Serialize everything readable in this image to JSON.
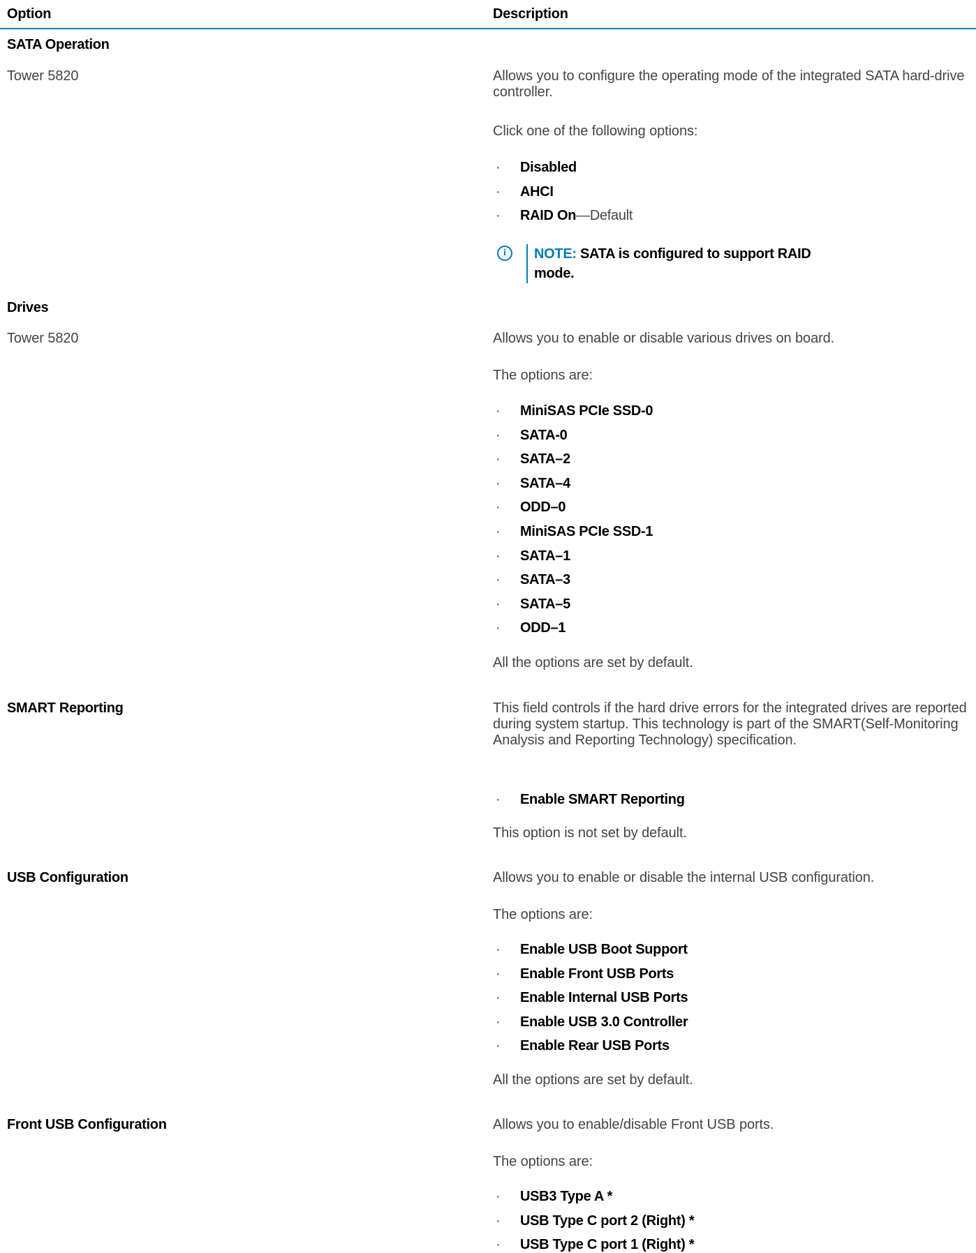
{
  "table": {
    "header": {
      "option": "Option",
      "description": "Description"
    }
  },
  "sata_operation": {
    "title": "SATA Operation",
    "model": "Tower 5820",
    "description": "Allows you to configure the operating mode of the integrated SATA hard-drive controller.",
    "prompt": "Click one of the following options:",
    "options": [
      {
        "label": "Disabled",
        "suffix": ""
      },
      {
        "label": "AHCI",
        "suffix": ""
      },
      {
        "label": "RAID On",
        "suffix": "—Default"
      }
    ],
    "note_label": "NOTE:",
    "note_text": " SATA is configured to support RAID mode."
  },
  "drives": {
    "title": "Drives",
    "model": "Tower 5820",
    "description": "Allows you to enable or disable various drives on board.",
    "prompt": "The options are:",
    "options": [
      "MiniSAS PCIe SSD-0",
      "SATA-0",
      "SATA–2",
      "SATA–4",
      "ODD–0",
      "MiniSAS PCIe SSD-1",
      "SATA–1",
      "SATA–3",
      "SATA–5",
      "ODD–1"
    ],
    "footer": "All the options are set by default."
  },
  "smart_reporting": {
    "title": "SMART Reporting",
    "description": "This field controls if the hard drive errors for the integrated drives are reported during system startup. This technology is part of the SMART(Self-Monitoring Analysis and Reporting Technology) specification.",
    "options": [
      "Enable SMART Reporting"
    ],
    "footer": "This option is not set by default."
  },
  "usb_configuration": {
    "title": "USB Configuration",
    "description": "Allows you to enable or disable the internal USB configuration.",
    "prompt": "The options are:",
    "options": [
      "Enable USB Boot Support",
      "Enable Front USB Ports",
      "Enable Internal USB Ports",
      "Enable USB 3.0 Controller",
      "Enable Rear USB Ports"
    ],
    "footer": "All the options are set by default."
  },
  "front_usb_configuration": {
    "title": "Front USB Configuration",
    "description": "Allows you to enable/disable Front USB ports.",
    "prompt": "The options are:",
    "options": [
      "USB3 Type A *",
      "USB Type C port 2 (Right) *",
      "USB Type C port 1 (Right) *"
    ]
  },
  "bullet_char": "·",
  "colors": {
    "accent": "#007db8",
    "heading": "#000000",
    "body": "#444444"
  }
}
